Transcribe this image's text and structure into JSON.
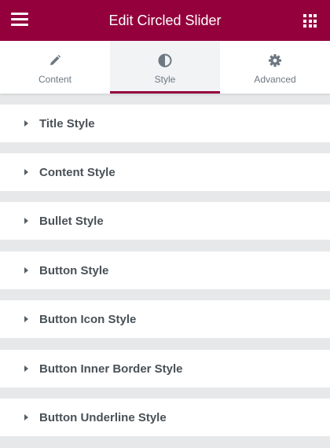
{
  "header": {
    "title": "Edit Circled Slider",
    "menu_icon": "hamburger-menu-icon",
    "apps_icon": "grid-apps-icon"
  },
  "tabs": [
    {
      "label": "Content",
      "icon": "pencil-icon",
      "active": false
    },
    {
      "label": "Style",
      "icon": "contrast-half-circle-icon",
      "active": true
    },
    {
      "label": "Advanced",
      "icon": "gear-icon",
      "active": false
    }
  ],
  "sections": [
    {
      "label": "Title Style"
    },
    {
      "label": "Content Style"
    },
    {
      "label": "Bullet Style"
    },
    {
      "label": "Button Style"
    },
    {
      "label": "Button Icon Style"
    },
    {
      "label": "Button Inner Border Style"
    },
    {
      "label": "Button Underline Style"
    }
  ],
  "colors": {
    "accent": "#93003c",
    "panel_background": "#e6e8ea",
    "section_text": "#495157",
    "tab_text": "#6d7882"
  }
}
